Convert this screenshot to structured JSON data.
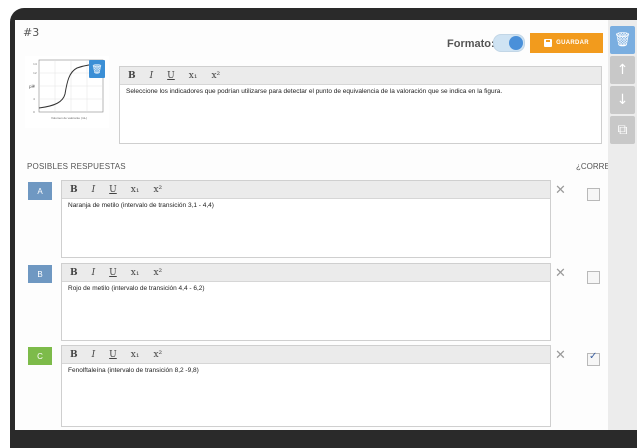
{
  "question": {
    "number": "#3",
    "formato_label": "Formato:",
    "save_label": "GUARDAR",
    "text": "Seleccione los indicadores que podrían utilizarse para detectar el punto de equivalencia de la valoración que se indica en la figura.",
    "figure_xlabel": "Volumen de valorante (mL)"
  },
  "section": {
    "answers_label": "POSIBLES RESPUESTAS",
    "correct_label": "¿CORRECTO?"
  },
  "options": [
    {
      "letter": "A",
      "text": "Naranja de metilo (intervalo de transición 3,1 - 4,4)",
      "correct": false,
      "color": "#6f98c2"
    },
    {
      "letter": "B",
      "text": "Rojo de metilo (intervalo de transición 4,4 - 6,2)",
      "correct": false,
      "color": "#6f98c2"
    },
    {
      "letter": "C",
      "text": "Fenolftaleína (intervalo de transición 8,2 -9,8)",
      "correct": true,
      "color": "#7dbb4a"
    }
  ],
  "toolbar": {
    "bold": "B",
    "italic": "I",
    "underline": "U",
    "subscript": "x₁",
    "superscript": "x²"
  },
  "colors": {
    "accent": "#4a90d9",
    "save": "#f29b1d",
    "option_a_b": "#6f98c2",
    "option_c": "#7dbb4a"
  },
  "side_icons": [
    "trash-icon",
    "arrow-up-icon",
    "arrow-down-icon",
    "copy-icon"
  ]
}
